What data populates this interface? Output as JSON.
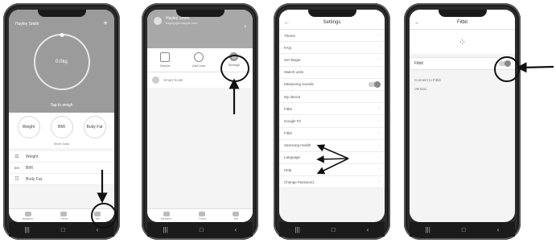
{
  "phone1": {
    "header_title": "Hayley Smith",
    "weight_value": "0.0kg",
    "tap_text": "Tap to weigh",
    "metrics": [
      "Weight",
      "BMI",
      "Body Fat"
    ],
    "more_data": "More Data",
    "rows": [
      {
        "icon": "⚖",
        "label": "Weight"
      },
      {
        "icon": "BMI",
        "label": "BMI"
      },
      {
        "icon": "☷",
        "label": "Body Fat"
      }
    ],
    "tabs": [
      "Measure",
      "Trend",
      "Me"
    ]
  },
  "phone2": {
    "user_name": "Hayley Smith",
    "user_sub": "hayley@example.com",
    "actions": [
      "Device",
      "Add User",
      "Settings"
    ],
    "device_text": "Smart Scale"
  },
  "phone3": {
    "title": "Settings",
    "rows": [
      "Theme",
      "FAQ",
      "Set Target",
      "Switch units",
      "Measuring sounds",
      "My device",
      "Fitbit",
      "Google Fit",
      "Fitbit",
      "Samsung Health",
      "Language",
      "Help",
      "Change Password"
    ]
  },
  "phone4": {
    "title": "Fitbit",
    "logo_glyph": "⁘",
    "fitbit_row": "Fitbit",
    "info": [
      "Connect to Fitbit",
      "Version"
    ]
  },
  "nav_glyphs": [
    "|||",
    "□",
    "‹"
  ]
}
